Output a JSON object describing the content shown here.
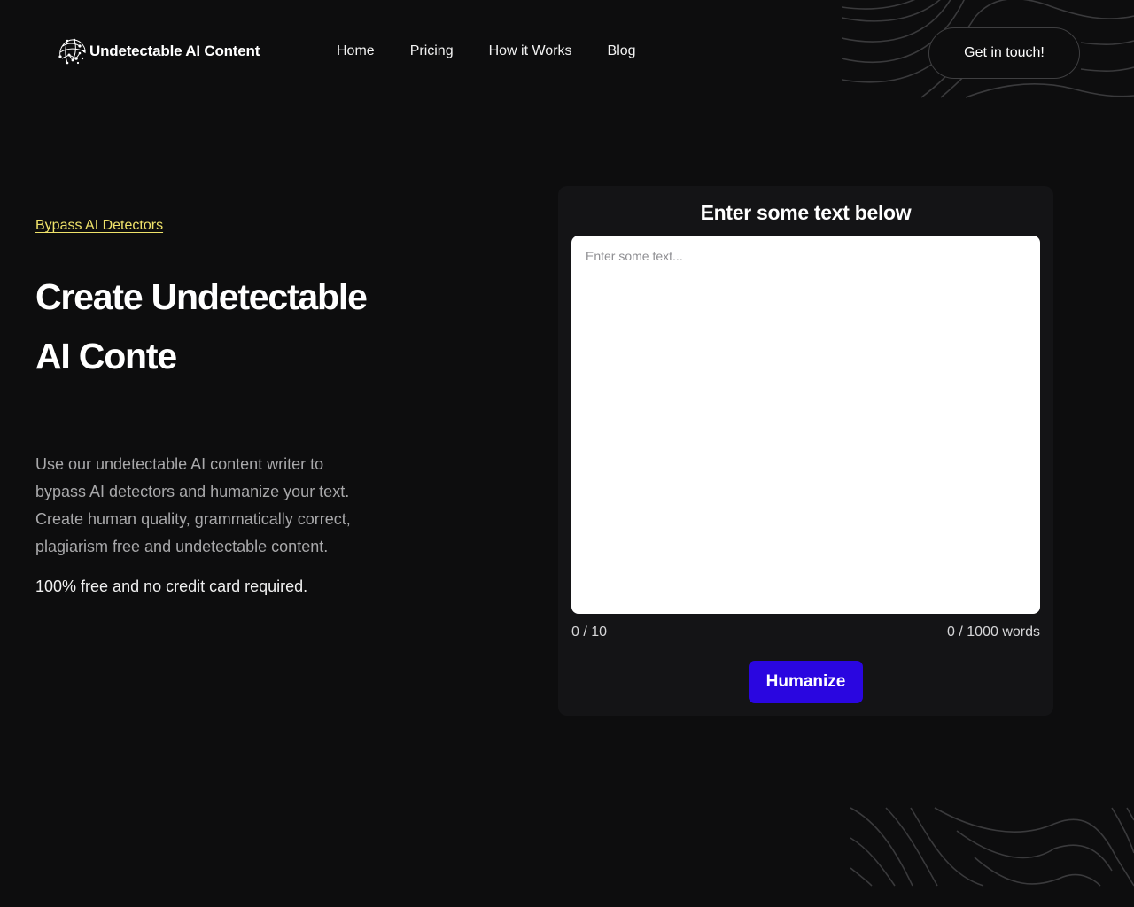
{
  "header": {
    "logo_text": "Undetectable AI Content",
    "logo_icon": "network-globe-icon",
    "nav": [
      {
        "label": "Home"
      },
      {
        "label": "Pricing"
      },
      {
        "label": "How it Works"
      },
      {
        "label": "Blog"
      }
    ],
    "cta_label": "Get in touch!"
  },
  "hero": {
    "eyebrow": "Bypass AI Detectors",
    "headline_line1": "Create Undetectable",
    "headline_line2": "AI Conte",
    "description_line1": "Use our undetectable AI content writer to bypass AI detectors and humanize your text.",
    "description_line2": "Create human quality, grammatically correct, plagiarism free and undetectable content.",
    "note": "100% free and no credit card required."
  },
  "tool": {
    "title": "Enter some text below",
    "input_value": "",
    "input_placeholder": "Enter some text...",
    "counter_left": "0 / 10",
    "counter_right": "0 / 1000 words",
    "button_label": "Humanize"
  },
  "colors": {
    "background": "#0d0d0e",
    "accent_yellow": "#efe26a",
    "button_blue": "#2a06e0",
    "card_bg": "#141416"
  }
}
